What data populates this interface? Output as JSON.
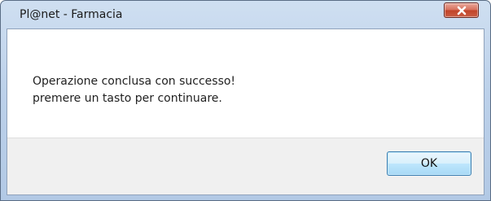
{
  "window": {
    "title": "Pl@net - Farmacia"
  },
  "titlebar": {
    "close_icon": "close-x-icon"
  },
  "message": {
    "line1": "Operazione conclusa con successo!",
    "line2": "premere un tasto per continuare."
  },
  "buttons": {
    "ok_label": "OK"
  },
  "colors": {
    "close_button": "#c24429",
    "ok_button_border": "#3c7fb1",
    "title_bar": "#bcd1ea"
  }
}
